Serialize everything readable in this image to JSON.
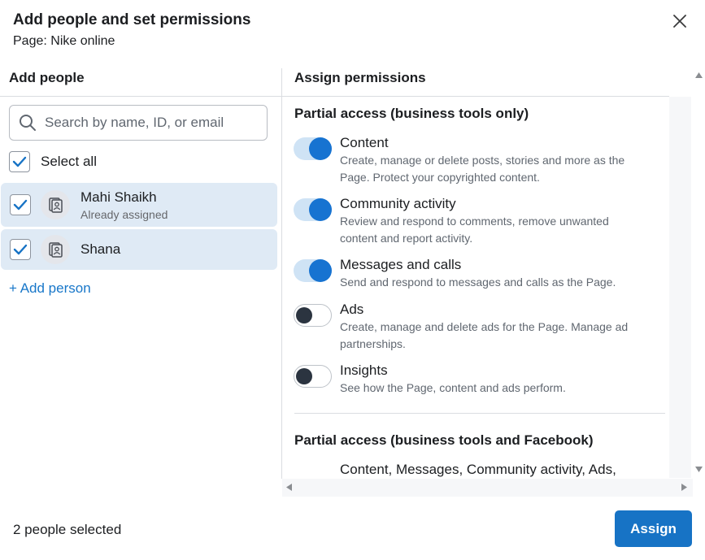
{
  "dialog": {
    "title": "Add people and set permissions",
    "subtitle": "Page: Nike online"
  },
  "left": {
    "heading": "Add people",
    "search_placeholder": "Search by name, ID, or email",
    "select_all_label": "Select all",
    "select_all_checked": true,
    "people": [
      {
        "name": "Mahi Shaikh",
        "status": "Already assigned",
        "checked": true
      },
      {
        "name": "Shana",
        "status": "",
        "checked": true
      }
    ],
    "add_person_label": "+ Add person"
  },
  "right": {
    "heading": "Assign permissions",
    "section1_title": "Partial access (business tools only)",
    "permissions": [
      {
        "title": "Content",
        "line1": "Create, manage or delete posts, stories and more as the",
        "line2": "Page. Protect your copyrighted content.",
        "enabled": true
      },
      {
        "title": "Community activity",
        "line1": "Review and respond to comments, remove unwanted",
        "line2": "content and report activity.",
        "enabled": true
      },
      {
        "title": "Messages and calls",
        "line1": "Send and respond to messages and calls as the Page.",
        "line2": "",
        "enabled": true
      },
      {
        "title": "Ads",
        "line1": "Create, manage and delete ads for the Page. Manage ad",
        "line2": "partnerships.",
        "enabled": false
      },
      {
        "title": "Insights",
        "line1": "See how the Page, content and ads perform.",
        "line2": "",
        "enabled": false
      }
    ],
    "section2_title": "Partial access (business tools and Facebook)",
    "section2_text": "Content, Messages, Community activity, Ads,"
  },
  "footer": {
    "selected_text": "2 people selected",
    "assign_label": "Assign"
  },
  "colors": {
    "accent": "#1773c5",
    "toggle_on": "#1773d1",
    "row_selected": "#dfeaf5",
    "link": "#1877c9"
  },
  "icons": [
    "close-icon",
    "search-icon",
    "checkmark-icon",
    "avatar-icon",
    "scroll-up-icon",
    "scroll-down-icon",
    "scroll-left-icon",
    "scroll-right-icon"
  ]
}
